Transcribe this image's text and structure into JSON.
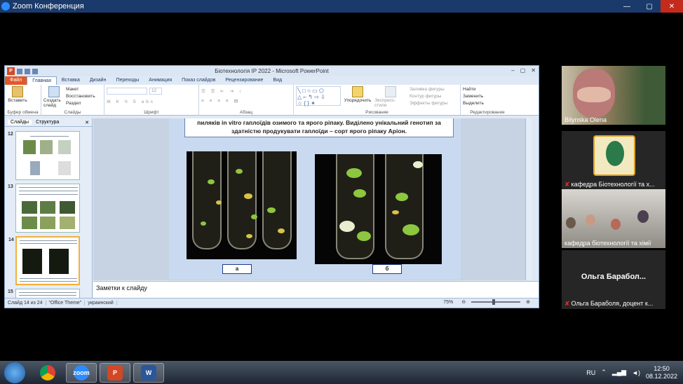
{
  "zoom": {
    "title": "Zoom Конференция"
  },
  "ppt": {
    "title": "Біотехнологія ІР 2022  -  Microsoft PowerPoint",
    "tabs": [
      "Файл",
      "Главная",
      "Вставка",
      "Дизайн",
      "Переходы",
      "Анимация",
      "Показ слайдов",
      "Рецензирование",
      "Вид"
    ],
    "ribbon": {
      "paste": "Вставить",
      "clipboard_group": "Буфер обмена",
      "create_slide": "Создать слайд",
      "layout": "Макет",
      "reset": "Восстановить",
      "section": "Раздел",
      "slides_group": "Слайды",
      "font_size": "12",
      "font_group": "Шрифт",
      "paragraph_group": "Абзац",
      "arrange": "Упорядочить",
      "quick_styles": "Экспресс-стили",
      "shape_fill": "Заливка фигуры",
      "shape_outline": "Контур фигуры",
      "shape_effects": "Эффекты фигуры",
      "drawing_group": "Рисование",
      "find": "Найти",
      "replace": "Заменить",
      "select": "Выделить",
      "editing_group": "Редактирование"
    },
    "left_pane": {
      "tab_slides": "Слайды",
      "tab_outline": "Структура",
      "slide_numbers": [
        "12",
        "13",
        "14",
        "15"
      ]
    },
    "slide": {
      "text_line1": "пиляків in vitro  гаплоїдів озимого та ярого ріпаку. Виділено унікальний генотип за",
      "text_line2": "здатністю продукувати гаплоїди – сорт ярого ріпаку Аріон.",
      "caption_a": "а",
      "caption_b": "б"
    },
    "notes_placeholder": "Заметки к слайду",
    "status": {
      "slide_info": "Слайд 14 из 24",
      "theme": "\"Office Theme\"",
      "language": "украинский",
      "zoom": "75%"
    }
  },
  "participants": [
    {
      "name": "Bilynska Olena",
      "muted": false
    },
    {
      "name": "кафедра Біотехнології та х...",
      "muted": true
    },
    {
      "name": "кафедра біотехнології та хімії",
      "muted": false
    },
    {
      "name": "Ольга Бараболя, доцент к...",
      "muted": true,
      "display_name": "Ольга  Барабол..."
    }
  ],
  "taskbar": {
    "apps": [
      "Chrome",
      "Zoom",
      "PowerPoint",
      "Word"
    ],
    "language": "RU",
    "time": "12:50",
    "date": "08.12.2022"
  }
}
